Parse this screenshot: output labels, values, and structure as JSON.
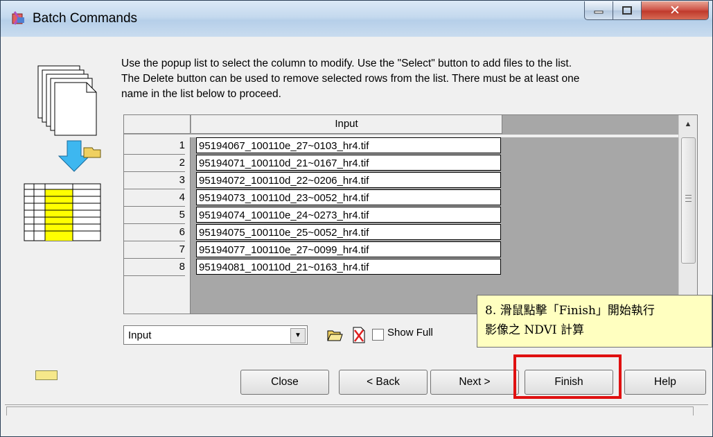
{
  "window": {
    "title": "Batch Commands"
  },
  "instructions": "Use the popup list to select the column to modify. Use the \"Select\" button to add files to the list. The Delete button can be used to remove selected rows from the list. There must be at least one name in the list below to proceed.",
  "grid": {
    "column_header": "Input",
    "rows": [
      {
        "num": "1",
        "file": "95194067_100110e_27~0103_hr4.tif"
      },
      {
        "num": "2",
        "file": "95194071_100110d_21~0167_hr4.tif"
      },
      {
        "num": "3",
        "file": "95194072_100110d_22~0206_hr4.tif"
      },
      {
        "num": "4",
        "file": "95194073_100110d_23~0052_hr4.tif"
      },
      {
        "num": "5",
        "file": "95194074_100110e_24~0273_hr4.tif"
      },
      {
        "num": "6",
        "file": "95194075_100110e_25~0052_hr4.tif"
      },
      {
        "num": "7",
        "file": "95194077_100110e_27~0099_hr4.tif"
      },
      {
        "num": "8",
        "file": "95194081_100110d_21~0163_hr4.tif"
      }
    ]
  },
  "column_select": {
    "value": "Input"
  },
  "show_full": {
    "label": "Show Full"
  },
  "callout": {
    "line1": "8. 滑鼠點擊「Finish」開始執行",
    "line2": "影像之 NDVI 計算"
  },
  "buttons": {
    "close": "Close",
    "back": "< Back",
    "next": "Next >",
    "finish": "Finish",
    "help": "Help"
  },
  "colors": {
    "highlight": "#e01010",
    "callout_bg": "#ffffc0",
    "title_gradient": "#c4d9ee"
  }
}
